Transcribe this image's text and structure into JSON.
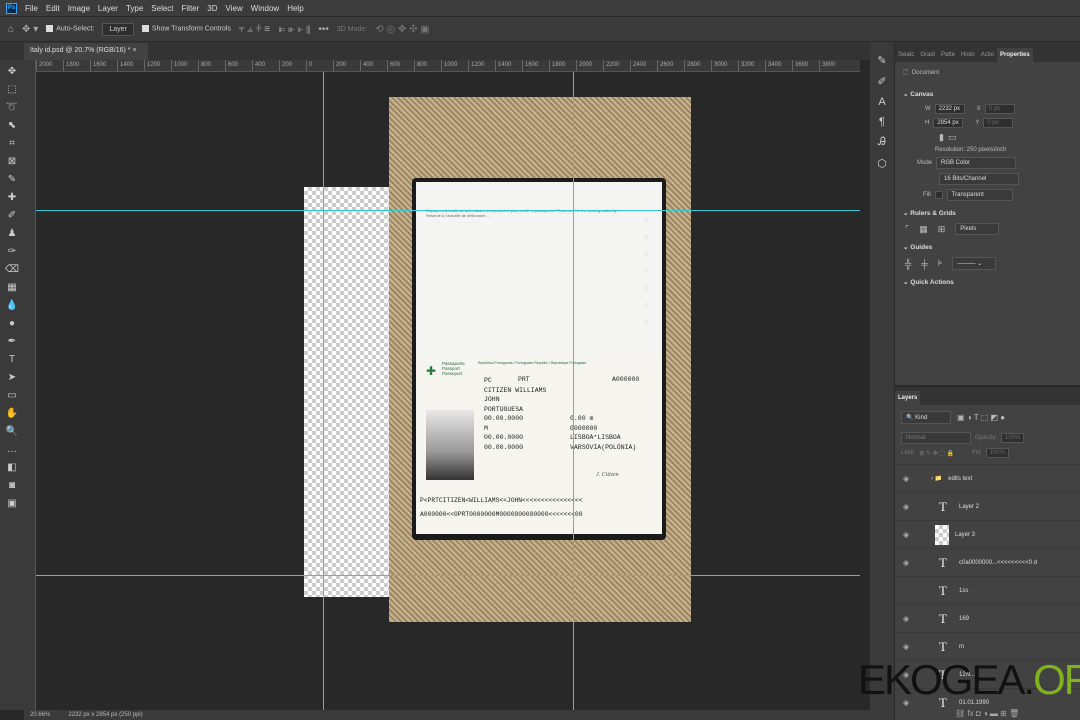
{
  "menu": [
    "File",
    "Edit",
    "Image",
    "Layer",
    "Type",
    "Select",
    "Filter",
    "3D",
    "View",
    "Window",
    "Help"
  ],
  "app_icon": "Ps",
  "options": {
    "auto_select": "Auto-Select:",
    "auto_select_target": "Layer",
    "show_transform": "Show Transform Controls",
    "mode_3d": "3D Mode:",
    "more": "•••"
  },
  "document_tab": {
    "title": "Italy id.psd @ 20.7% (RGB/16) *",
    "close": "×"
  },
  "ruler_labels": [
    "2000",
    "1800",
    "1600",
    "1400",
    "1200",
    "1000",
    "800",
    "600",
    "400",
    "200",
    "0",
    "200",
    "400",
    "600",
    "800",
    "1000",
    "1200",
    "1400",
    "1600",
    "1800",
    "2000",
    "2200",
    "2400",
    "2600",
    "2800",
    "3000",
    "3200",
    "3400",
    "3600",
    "3800"
  ],
  "status": {
    "zoom": "20.66%",
    "doc_info": "2232 px x 2854 px (250 ppi)"
  },
  "passport": {
    "header_label": [
      "Passaporte",
      "Passport",
      "Passeport"
    ],
    "country_header": "República Portuguesa / Portuguese Republic / République Portugaise",
    "type": "PC",
    "code": "PRT",
    "number": "A000000",
    "surname": "CITIZEN WILLIAMS",
    "given": "JOHN",
    "nationality": "PORTUGUESA",
    "height": "0.00 m",
    "dob": "00.00.0000",
    "id_no": "0000000",
    "sex": "M",
    "birth_place": "LISBOA*LISBOA",
    "issue": "00.00.0000",
    "authority": "VARSÓVIA(POLÓNIA)",
    "expiry": "00.00.0000",
    "signature": "J. Citizen",
    "mrz1": "P<PRTCITIZEN<WILLIAMS<<JOHN<<<<<<<<<<<<<<<<",
    "mrz2": "A000000<<0PRT0000000M0000000000000<<<<<<<00",
    "top_text": "Espaço reservado às autoridades competentes para emitir o passaporte / Reserved for the issuing authority / Réservé à l'autorité de délivrance ..."
  },
  "properties": {
    "tabs": [
      "Swatc",
      "Gradi",
      "Patte",
      "Histo",
      "Actio",
      "Properties"
    ],
    "document": "Document",
    "canvas": "Canvas",
    "w_label": "W",
    "w": "2232 px",
    "h_label": "H",
    "h": "2854 px",
    "x_label": "X",
    "y_label": "Y",
    "x": "0 px",
    "y": "0 px",
    "resolution": "Resolution: 250 pixels/inch",
    "mode_label": "Mode",
    "mode": "RGB Color",
    "depth": "16 Bits/Channel",
    "fill_label": "Fill",
    "fill": "Transparent",
    "rulers": "Rulers & Grids",
    "units": "Pixels",
    "guides": "Guides",
    "quick_actions": "Quick Actions"
  },
  "layers": {
    "title": "Layers",
    "kind": "Kind",
    "blend": "Normal",
    "opacity_label": "Opacity:",
    "opacity": "100%",
    "lock_label": "Lock:",
    "fill_label": "Fill:",
    "fill": "100%",
    "items": [
      {
        "name": "edits text",
        "type": "group"
      },
      {
        "name": "Layer 2",
        "type": "text"
      },
      {
        "name": "Layer 3",
        "type": "raster"
      },
      {
        "name": "c0a0000000...<<<<<<<<<0 d",
        "type": "text"
      },
      {
        "name": "1ss",
        "type": "text"
      },
      {
        "name": "169",
        "type": "text"
      },
      {
        "name": "m",
        "type": "text"
      },
      {
        "name": "12N...",
        "type": "text"
      },
      {
        "name": "01.01.1990",
        "type": "text"
      }
    ]
  },
  "watermark": {
    "part1": "EKOGEA.",
    "part2": "ORG"
  },
  "colors": {
    "guide": "#35c7d0",
    "watermark_green": "#7fb21d",
    "accent": "#31a8ff"
  }
}
